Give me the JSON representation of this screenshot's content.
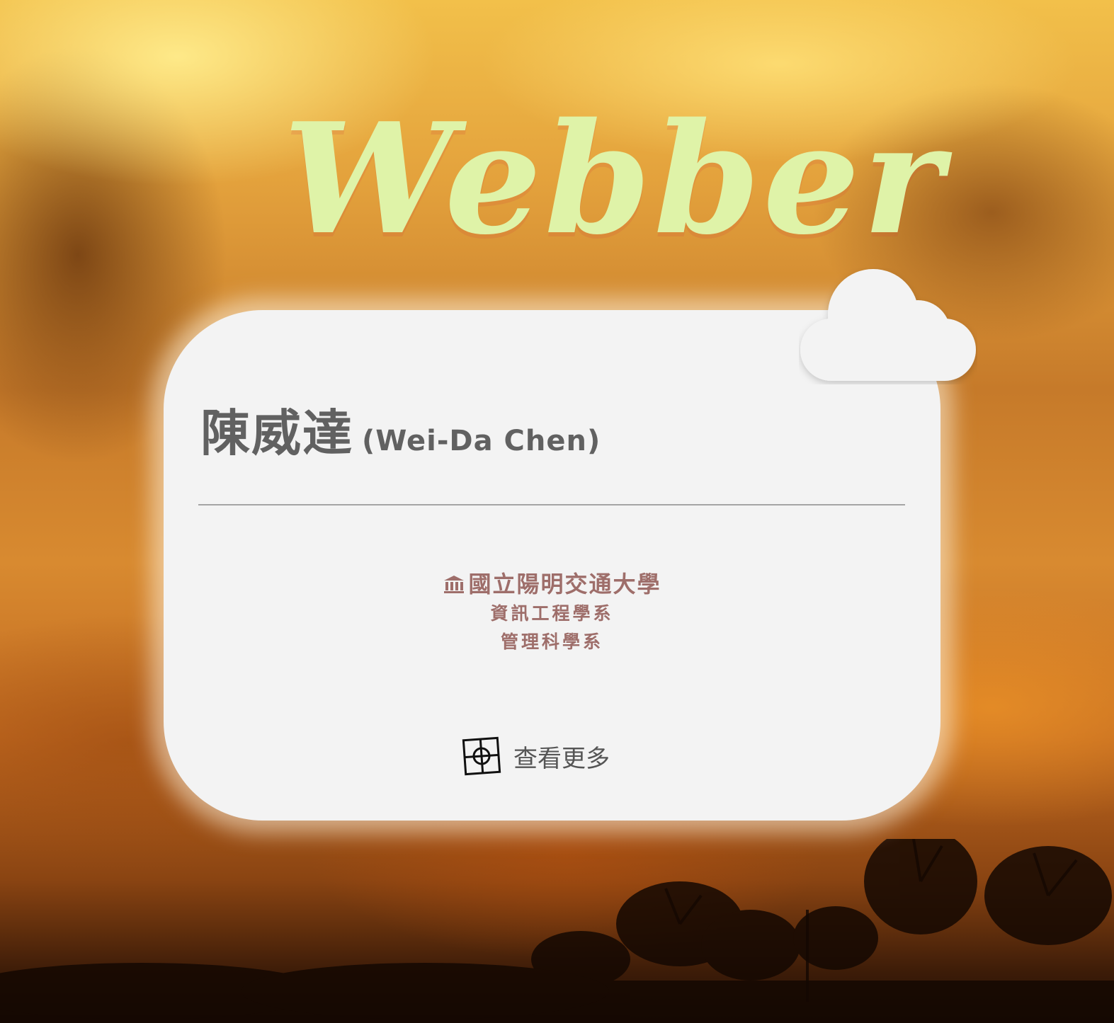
{
  "site": {
    "logo_text": "Webber"
  },
  "profile": {
    "name_zh": "陳威達",
    "name_en": "(Wei-Da Chen)",
    "school": "國立陽明交通大學",
    "school_icon": "institution-icon",
    "departments": [
      "資訊工程學系",
      "管理科學系"
    ]
  },
  "actions": {
    "more_label": "查看更多",
    "more_icon": "crosshair-square-icon"
  },
  "colors": {
    "logo": "#dff3a8",
    "card_bg": "#f3f3f3",
    "name": "#616161",
    "affiliation": "#9e6e6a"
  }
}
